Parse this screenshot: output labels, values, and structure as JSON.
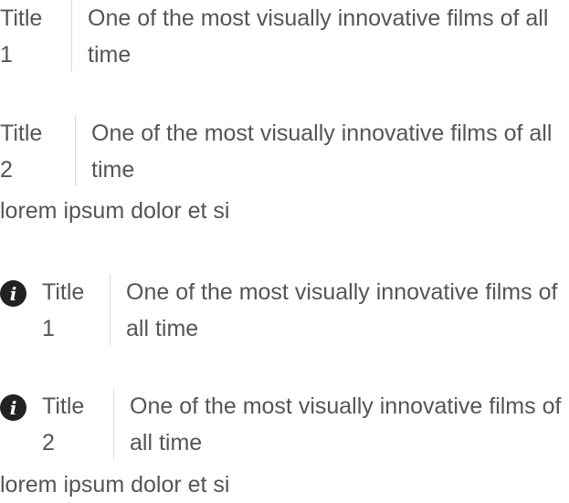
{
  "items": [
    {
      "title": "Title\n1",
      "description": "One of the most visually innovative films of all time"
    },
    {
      "title": "Title\n2",
      "description": "One of the most visually innovative films of all time"
    },
    {
      "title": "Title\n1",
      "description": "One of the most visually innovative films of all time"
    },
    {
      "title": "Title\n2",
      "description": "One of the most visually innovative films of all time"
    }
  ],
  "footers": [
    "lorem ipsum dolor et si",
    "lorem ipsum dolor et si"
  ],
  "icon": {
    "name": "info-icon",
    "glyph": "i",
    "color": "#222222"
  }
}
